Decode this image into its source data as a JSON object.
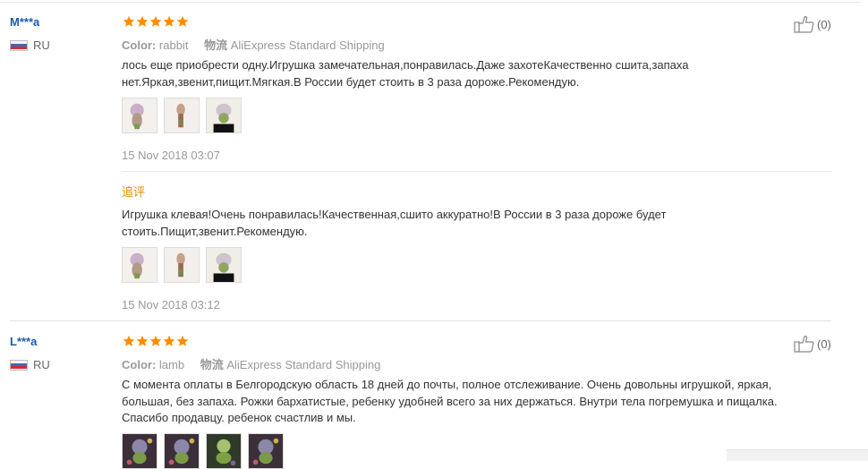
{
  "reviews": [
    {
      "user": "M***a",
      "country": "RU",
      "rating": 5,
      "helpful_count": "(0)",
      "color_label": "Color:",
      "color_value": "rabbit",
      "shipping_label": "物流",
      "shipping_value": "AliExpress Standard Shipping",
      "text": "лось еще приобрести одну.Игрушка замечательная,понравилась.Даже захотеКачественно сшита,запаха нет.Яркая,звенит,пищит.Мягкая.В России будет стоить в 3 раза дороже.Рекомендую.",
      "photos": [
        "photo-1",
        "photo-2",
        "photo-3"
      ],
      "date": "15 Nov 2018 03:07",
      "additional": {
        "label": "追评",
        "text": "Игрушка клевая!Очень понравилась!Качественная,сшито аккуратно!В России в 3 раза дороже будет стоить.Пищит,звенит.Рекомендую.",
        "photos": [
          "photo-1",
          "photo-2",
          "photo-3"
        ],
        "date": "15 Nov 2018 03:12"
      }
    },
    {
      "user": "L***a",
      "country": "RU",
      "rating": 5,
      "helpful_count": "(0)",
      "color_label": "Color:",
      "color_value": "lamb",
      "shipping_label": "物流",
      "shipping_value": "AliExpress Standard Shipping",
      "text": "С момента оплаты в Белгородскую область 18 дней до почты, полное отслеживание. Очень довольны игрушкой, яркая, большая, без запаха. Рожки бархатистые, ребенку удобней всего за них держаться. Внутри тела погремушка и пищалка. Спасибо продавцу. ребенок счастлив и мы.",
      "photos": [
        "photo-1",
        "photo-2",
        "photo-3",
        "photo-4"
      ]
    }
  ],
  "colors": {
    "star": "#ff8c00",
    "username": "#1a5aa8",
    "additional_label": "#e08a00"
  },
  "icons": {
    "helpful": "thumbs-up-icon",
    "country": "russia-flag-icon",
    "rating": "star-icon"
  }
}
